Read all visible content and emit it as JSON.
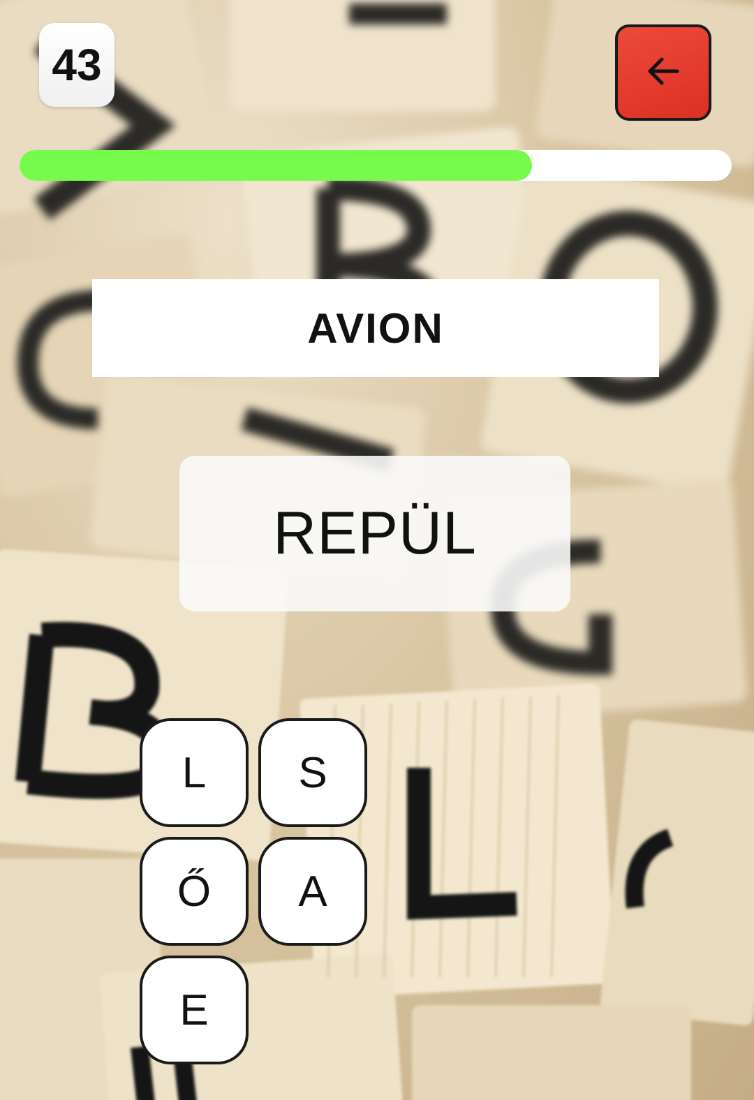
{
  "counter": {
    "value": "43"
  },
  "back_button": {
    "icon": "arrow-left-icon"
  },
  "progress": {
    "fraction": 0.72,
    "color": "#76fb4c"
  },
  "word": {
    "text": "AVION"
  },
  "answer": {
    "text": "REPÜL"
  },
  "letters": [
    "L",
    "S",
    "Ő",
    "A",
    "E"
  ],
  "background": {
    "description_icon": "scrabble-tiles-background"
  },
  "colors": {
    "back_button": "#e13a2c",
    "progress_fill": "#76fb4c",
    "tile_border": "#1a1a1a"
  }
}
